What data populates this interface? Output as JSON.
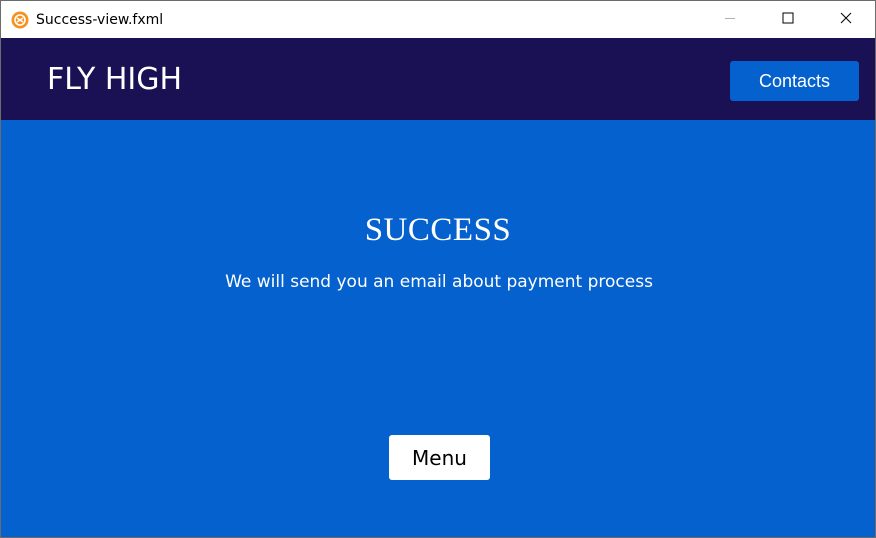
{
  "window": {
    "title": "Success-view.fxml",
    "icon": "javafx-app-icon",
    "controls": [
      "minimize-icon",
      "maximize-icon",
      "close-icon"
    ]
  },
  "header": {
    "brand": "FLY HIGH",
    "contacts_label": "Contacts"
  },
  "main": {
    "title": "SUCCESS",
    "message": "We will send you an email about payment process",
    "menu_label": "Menu"
  },
  "colors": {
    "header_bg": "#1a1054",
    "main_bg": "#0561ce",
    "button_blue": "#0561ce",
    "text_white": "#ffffff"
  }
}
